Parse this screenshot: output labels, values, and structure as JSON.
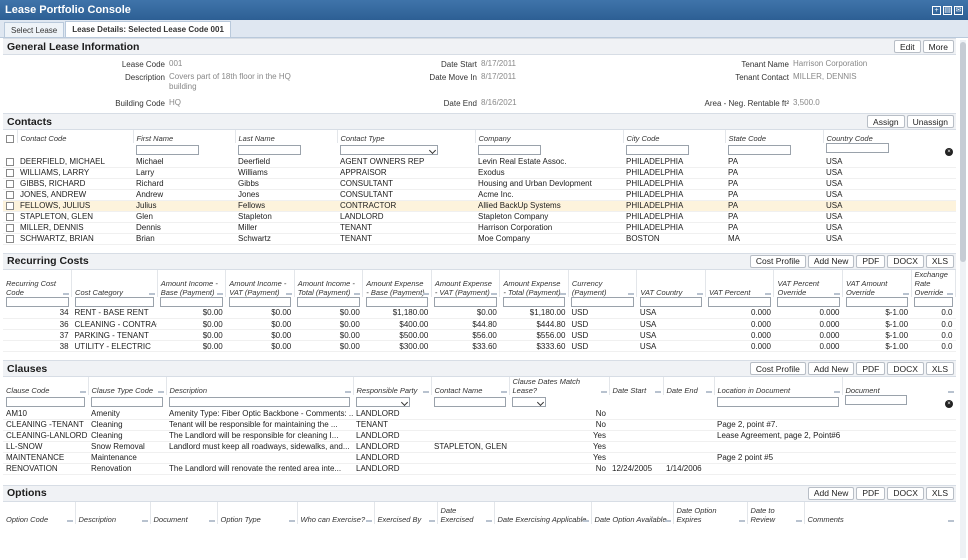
{
  "app": {
    "title": "Lease Portfolio Console",
    "tabs": [
      "Select Lease",
      "Lease Details: Selected Lease Code 001"
    ]
  },
  "general": {
    "title": "General Lease Information",
    "buttons": [
      "Edit",
      "More"
    ],
    "lease_code_label": "Lease Code",
    "lease_code": "001",
    "description_label": "Description",
    "description": "Covers part of 18th floor in the HQ building",
    "building_code_label": "Building Code",
    "building_code": "HQ",
    "date_start_label": "Date Start",
    "date_start": "8/17/2011",
    "date_move_in_label": "Date Move In",
    "date_move_in": "8/17/2011",
    "date_end_label": "Date End",
    "date_end": "8/16/2021",
    "tenant_name_label": "Tenant Name",
    "tenant_name": "Harrison Corporation",
    "tenant_contact_label": "Tenant Contact",
    "tenant_contact": "MILLER, DENNIS",
    "area_label": "Area - Neg. Rentable ft²",
    "area": "3,500.0"
  },
  "contacts": {
    "title": "Contacts",
    "buttons": [
      "Assign",
      "Unassign"
    ],
    "columns": [
      "Contact Code",
      "First Name",
      "Last Name",
      "Contact Type",
      "Company",
      "City Code",
      "State Code",
      "Country Code"
    ],
    "rows": [
      [
        "DEERFIELD, MICHAEL",
        "Michael",
        "Deerfield",
        "AGENT OWNERS REP",
        "Levin Real Estate Assoc.",
        "PHILADELPHIA",
        "PA",
        "USA"
      ],
      [
        "WILLIAMS, LARRY",
        "Larry",
        "Williams",
        "APPRAISOR",
        "Exodus",
        "PHILADELPHIA",
        "PA",
        "USA"
      ],
      [
        "GIBBS, RICHARD",
        "Richard",
        "Gibbs",
        "CONSULTANT",
        "Housing and Urban Devlopment",
        "PHILADELPHIA",
        "PA",
        "USA"
      ],
      [
        "JONES, ANDREW",
        "Andrew",
        "Jones",
        "CONSULTANT",
        "Acme Inc.",
        "PHILADELPHIA",
        "PA",
        "USA"
      ],
      [
        "FELLOWS, JULIUS",
        "Julius",
        "Fellows",
        "CONTRACTOR",
        "Allied BackUp Systems",
        "PHILADELPHIA",
        "PA",
        "USA"
      ],
      [
        "STAPLETON, GLEN",
        "Glen",
        "Stapleton",
        "LANDLORD",
        "Stapleton Company",
        "PHILADELPHIA",
        "PA",
        "USA"
      ],
      [
        "MILLER, DENNIS",
        "Dennis",
        "Miller",
        "TENANT",
        "Harrison Corporation",
        "PHILADELPHIA",
        "PA",
        "USA"
      ],
      [
        "SCHWARTZ, BRIAN",
        "Brian",
        "Schwartz",
        "TENANT",
        "Moe Company",
        "BOSTON",
        "MA",
        "USA"
      ]
    ]
  },
  "costs": {
    "title": "Recurring Costs",
    "buttons": [
      "Cost Profile",
      "Add New",
      "PDF",
      "DOCX",
      "XLS"
    ],
    "columns": [
      "Recurring Cost Code",
      "Cost Category",
      "Amount Income - Base (Payment)",
      "Amount Income - VAT (Payment)",
      "Amount Income - Total (Payment)",
      "Amount Expense - Base (Payment)",
      "Amount Expense - VAT (Payment)",
      "Amount Expense - Total (Payment)",
      "Currency (Payment)",
      "VAT Country",
      "VAT Percent",
      "VAT Percent Override",
      "VAT Amount Override",
      "Exchange Rate Override"
    ],
    "rows": [
      [
        "34",
        "RENT - BASE RENT",
        "$0.00",
        "$0.00",
        "$0.00",
        "$1,180.00",
        "$0.00",
        "$1,180.00",
        "USD",
        "USA",
        "0.000",
        "0.000",
        "$-1.00",
        "0.0"
      ],
      [
        "36",
        "CLEANING - CONTRACT",
        "$0.00",
        "$0.00",
        "$0.00",
        "$400.00",
        "$44.80",
        "$444.80",
        "USD",
        "USA",
        "0.000",
        "0.000",
        "$-1.00",
        "0.0"
      ],
      [
        "37",
        "PARKING - TENANT",
        "$0.00",
        "$0.00",
        "$0.00",
        "$500.00",
        "$56.00",
        "$556.00",
        "USD",
        "USA",
        "0.000",
        "0.000",
        "$-1.00",
        "0.0"
      ],
      [
        "38",
        "UTILITY - ELECTRIC",
        "$0.00",
        "$0.00",
        "$0.00",
        "$300.00",
        "$33.60",
        "$333.60",
        "USD",
        "USA",
        "0.000",
        "0.000",
        "$-1.00",
        "0.0"
      ]
    ]
  },
  "clauses": {
    "title": "Clauses",
    "buttons": [
      "Cost Profile",
      "Add New",
      "PDF",
      "DOCX",
      "XLS"
    ],
    "columns": [
      "Clause Code",
      "Clause Type Code",
      "Description",
      "Responsible Party",
      "Contact Name",
      "Clause Dates Match Lease?",
      "Date Start",
      "Date End",
      "Location in Document",
      "Document"
    ],
    "rows": [
      [
        "AM10",
        "Amenity",
        "Amenity Type: Fiber Optic Backbone - Comments: ...",
        "LANDLORD",
        "",
        "No",
        "",
        "",
        "",
        ""
      ],
      [
        "CLEANING -TENANT",
        "Cleaning",
        "Tenant will be responsible for maintaining the ...",
        "TENANT",
        "",
        "No",
        "",
        "",
        "Page 2, point #7.",
        ""
      ],
      [
        "CLEANING-LANLORD",
        "Cleaning",
        "The Landlord will be responsible for cleaning I...",
        "LANDLORD",
        "",
        "Yes",
        "",
        "",
        "Lease Agreement, page 2, Point#6",
        ""
      ],
      [
        "LL-SNOW",
        "Snow Removal",
        "Landlord must keep all roadways, sidewalks, and...",
        "LANDLORD",
        "STAPLETON, GLEN",
        "Yes",
        "",
        "",
        "",
        ""
      ],
      [
        "MAINTENANCE",
        "Maintenance",
        "",
        "LANDLORD",
        "",
        "Yes",
        "",
        "",
        "Page 2 point #5",
        ""
      ],
      [
        "RENOVATION",
        "Renovation",
        "The Landlord will renovate the rented area inte...",
        "LANDLORD",
        "",
        "No",
        "12/24/2005",
        "1/14/2006",
        "",
        ""
      ]
    ]
  },
  "options": {
    "title": "Options",
    "buttons": [
      "Add New",
      "PDF",
      "DOCX",
      "XLS"
    ],
    "columns": [
      "Option Code",
      "Description",
      "Document",
      "Option Type",
      "Who can Exercise?",
      "Exercised By",
      "Date Exercised",
      "Date Exercising Applicable",
      "Date Option Available",
      "Date Option Expires",
      "Date to Review",
      "Comments"
    ]
  }
}
